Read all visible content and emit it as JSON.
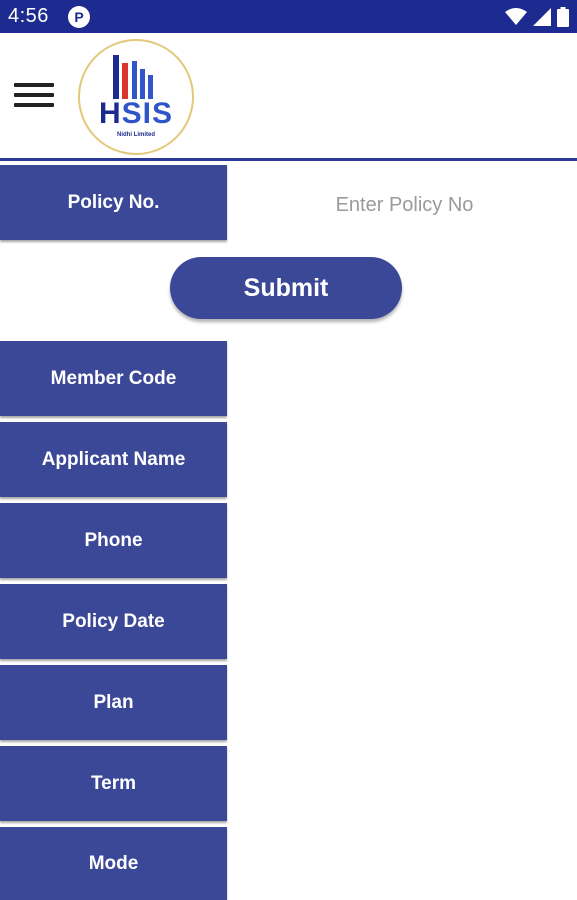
{
  "status_bar": {
    "time": "4:56",
    "app_badge": "P",
    "icons": [
      "wifi-icon",
      "signal-icon",
      "battery-icon"
    ],
    "background_color": "#1d2a8f"
  },
  "header": {
    "menu_icon": "hamburger-menu-icon",
    "logo_text": "HSIS",
    "logo_subtext": "Nidhi Limited"
  },
  "form": {
    "policy_label": "Policy No.",
    "policy_placeholder": "Enter Policy No",
    "policy_value": "",
    "submit_label": "Submit"
  },
  "details": [
    {
      "label": "Member Code",
      "value": ""
    },
    {
      "label": "Applicant Name",
      "value": ""
    },
    {
      "label": "Phone",
      "value": ""
    },
    {
      "label": "Policy Date",
      "value": ""
    },
    {
      "label": "Plan",
      "value": ""
    },
    {
      "label": "Term",
      "value": ""
    },
    {
      "label": "Mode",
      "value": ""
    }
  ],
  "colors": {
    "accent": "#3b4897",
    "header_bar": "#1d2a8f",
    "logo_red": "#d9352a",
    "logo_blue": "#2f55c8",
    "logo_ring": "#e2c878"
  }
}
